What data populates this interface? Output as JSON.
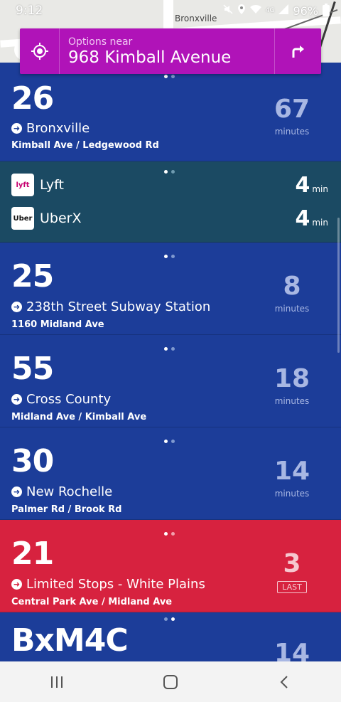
{
  "status_bar": {
    "time": "9:12",
    "network": "4G",
    "battery": "96%",
    "icons": [
      "mute-icon",
      "location-icon",
      "wifi-icon",
      "signal-icon",
      "battery-icon"
    ]
  },
  "map": {
    "label": "Bronxville"
  },
  "location": {
    "subtitle": "Options near",
    "address": "968 Kimball Avenue"
  },
  "routes": [
    {
      "number": "26",
      "destination": "Bronxville",
      "stop": "Kimball Ave / Ledgewood Rd",
      "eta": "67",
      "unit": "minutes"
    },
    {
      "number": "25",
      "destination": "238th Street Subway Station",
      "stop": "1160 Midland Ave",
      "eta": "8",
      "unit": "minutes"
    },
    {
      "number": "55",
      "destination": "Cross County",
      "stop": "Midland Ave / Kimball Ave",
      "eta": "18",
      "unit": "minutes"
    },
    {
      "number": "30",
      "destination": "New Rochelle",
      "stop": "Palmer Rd / Brook Rd",
      "eta": "14",
      "unit": "minutes"
    },
    {
      "number": "21",
      "destination": "Limited Stops - White Plains",
      "stop": "Central Park Ave / Midland Ave",
      "eta": "3",
      "badge": "LAST"
    },
    {
      "number": "BxM4C",
      "eta": "14"
    }
  ],
  "rideshare": [
    {
      "logo": "lyft",
      "name": "Lyft",
      "eta": "4",
      "unit": "min"
    },
    {
      "logo": "Uber",
      "name": "UberX",
      "eta": "4",
      "unit": "min"
    }
  ],
  "colors": {
    "route_blue": "#1c3d99",
    "alert_red": "#d7223f",
    "rideshare_teal": "#1b4a63",
    "location_purple": "#b013b8"
  }
}
